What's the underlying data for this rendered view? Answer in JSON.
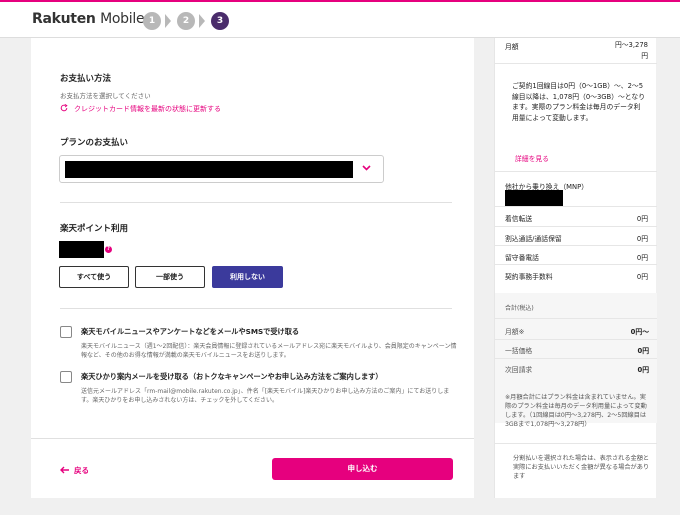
{
  "header": {
    "logo_brand": "Rakuten",
    "logo_product": "Mobile",
    "steps": [
      "1",
      "2",
      "3"
    ]
  },
  "payment": {
    "title": "お支払い方法",
    "subtitle": "お支払方法を選択してください",
    "refresh_link": "クレジットカード情報を最新の状態に更新する",
    "plan_label": "プランのお支払い"
  },
  "points": {
    "title": "楽天ポイント利用",
    "q_mark": "?",
    "buttons": [
      "すべて使う",
      "一部使う",
      "利用しない"
    ],
    "selected_index": 2
  },
  "consents": [
    {
      "label": "楽天モバイルニュースやアンケートなどをメールやSMSで受け取る",
      "desc": "楽天モバイルニュース（週1〜2回配信）：楽天会員情報に登録されているメールアドレス宛に楽天モバイルより、会員限定のキャンペーン情報など、その他のお得な情報が満載の楽天モバイルニュースをお送りします。"
    },
    {
      "label": "楽天ひかり案内メールを受け取る（おトクなキャンペーンやお申し込み方法をご案内します）",
      "desc": "送信元メールアドレス「rm-mail@mobile.rakuten.co.jp」、件名「[楽天モバイル]楽天ひかりお申し込み方法のご案内」にてお送りします。楽天ひかりをお申し込みされない方は、チェックを外してください。"
    }
  ],
  "footer": {
    "back_label": "戻る",
    "submit_label": "申し込む"
  },
  "summary": {
    "monthly_label": "月額",
    "monthly_value_1": "円〜3,278",
    "monthly_value_2": "円",
    "plan_note": "ご契約1回線目は0円（0〜1GB）〜、2〜5線目以降は、1,078円（0〜3GB）〜となります。実際のプラン料金は毎月のデータ利用量によって変動します。",
    "detail_link": "詳細を見る",
    "mnp_label": "他社から乗り換え（MNP）",
    "fees": [
      {
        "label": "着信転送",
        "value": "0円"
      },
      {
        "label": "割込通話/通話保留",
        "value": "0円"
      },
      {
        "label": "留守番電話",
        "value": "0円"
      },
      {
        "label": "契約事務手数料",
        "value": "0円"
      }
    ],
    "total_title": "合計(税込)",
    "totals": [
      {
        "label": "月額※",
        "value": "0円〜"
      },
      {
        "label": "一括価格",
        "value": "0円"
      },
      {
        "label": "次回請求",
        "value": "0円"
      }
    ],
    "footnote": "※月額合計にはプラン料金は含まれていません。実際のプラン料金は毎月のデータ利用量によって変動します。（1回線目は0円〜3,278円、2〜5回線目は3GBまで1,078円〜3,278円）",
    "installment_note": "分割払いを選択された場合は、表示される金額と実際にお支払いいただく金額が異なる場合があります"
  },
  "colors": {
    "accent": "#e6007e",
    "selected_button": "#3b3a9c",
    "active_step": "#4a2c6b"
  }
}
